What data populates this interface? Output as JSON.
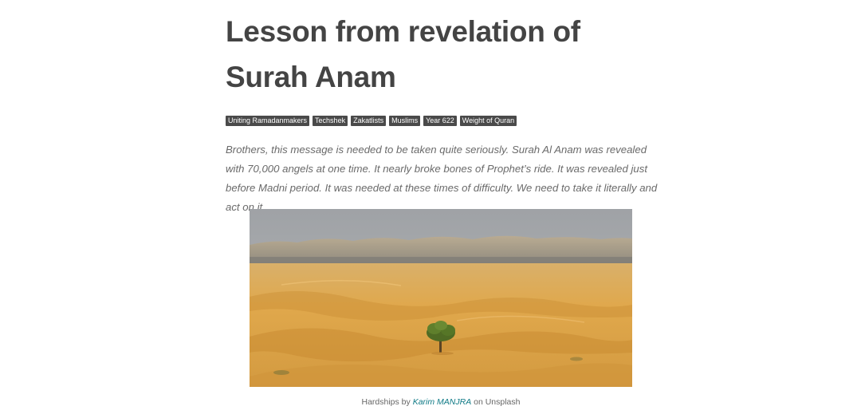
{
  "article": {
    "title": "Lesson from revelation of Surah Anam",
    "tags": [
      "Uniting Ramadanmakers",
      "Techshek",
      "Zakatlists",
      "Muslims",
      "Year 622",
      "Weight of Quran"
    ],
    "excerpt": "Brothers, this message is needed to be taken quite seriously. Surah Al Anam was revealed with 70,000 angels at one time. It nearly broke bones of Prophet’s ride. It was revealed just before Madni period. It was needed at these times of difficulty. We need to take it literally and act on it."
  },
  "image": {
    "subject": "desert-dunes-with-lone-tree"
  },
  "caption": {
    "prefix": "Hardships by ",
    "author": "Karim MANJRA",
    "suffix": " on Unsplash"
  },
  "colors": {
    "title": "#444444",
    "tag_bg": "#4a4a4a",
    "link": "#0f7a86",
    "sand": "#dca24a",
    "sky": "#a9acaf"
  }
}
